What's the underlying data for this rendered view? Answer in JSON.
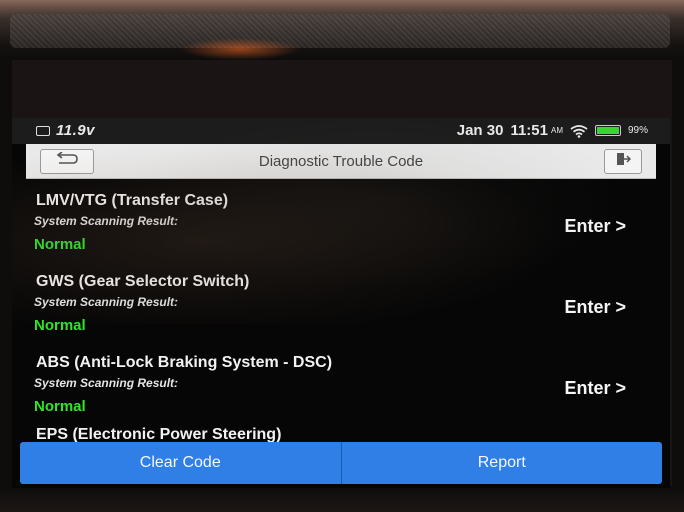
{
  "status_bar": {
    "voltage": "11.9v",
    "date": "Jan 30",
    "time": "11:51",
    "ampm": "AM",
    "battery": "99%",
    "battery_level": 0.99,
    "icons": [
      "car-battery-icon",
      "wifi-icon",
      "battery-icon"
    ]
  },
  "header": {
    "title": "Diagnostic Trouble Code",
    "icons": [
      "back-arrow-icon",
      "exit-icon"
    ]
  },
  "systems": [
    {
      "name": "LMV/VTG (Transfer Case)",
      "result_label": "System Scanning Result:",
      "status": "Normal",
      "action": "Enter >"
    },
    {
      "name": "GWS (Gear Selector Switch)",
      "result_label": "System Scanning Result:",
      "status": "Normal",
      "action": "Enter >"
    },
    {
      "name": "ABS (Anti-Lock Braking System - DSC)",
      "result_label": "System Scanning Result:",
      "status": "Normal",
      "action": "Enter >"
    }
  ],
  "partial_item": "EPS (Electronic Power Steering)",
  "footer": {
    "clear_label": "Clear Code",
    "report_label": "Report"
  },
  "colors": {
    "status_normal": "#2ee52a",
    "button_bar": "#2f7fe6",
    "screen_bg": "#060606",
    "titlebar_bg": "#e9e9e9"
  }
}
